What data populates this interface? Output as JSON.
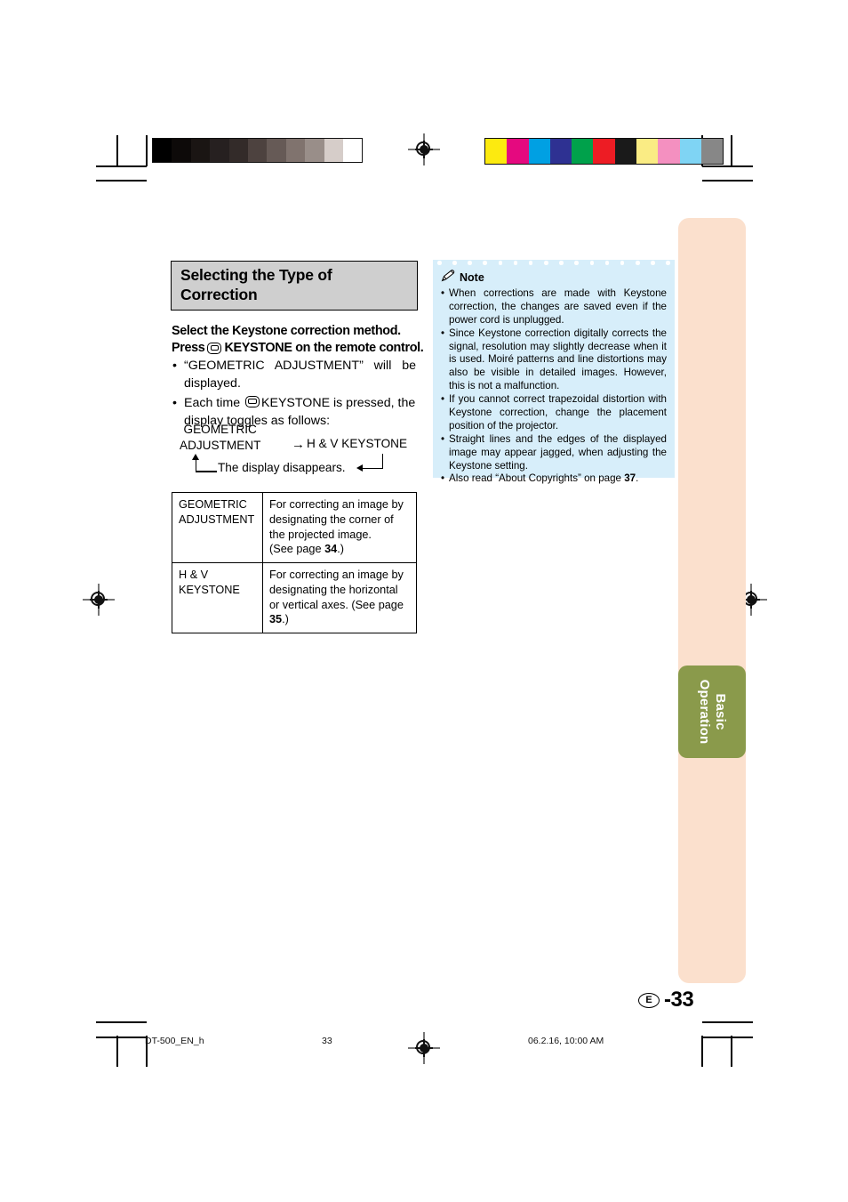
{
  "page": {
    "badge_region": "E",
    "badge_number": "-33"
  },
  "heading": {
    "title": "Selecting the Type of\nCorrection"
  },
  "lead": {
    "line1": "Select the Keystone correction method.",
    "press_prefix": "Press",
    "key_icon": "keystone-button-icon",
    "press_suffix": "KEYSTONE on the remote control."
  },
  "bullets": [
    "“GEOMETRIC ADJUSTMENT” will be displayed.",
    "Each time KEYSTONE is pressed, the display toggles as follows:"
  ],
  "bullet2": {
    "before_icon": "Each time",
    "icon": "keystone-button-icon",
    "after_icon": "KEYSTONE is pressed, the",
    "line2": "display toggles as follows:"
  },
  "flow": {
    "node1": "GEOMETRIC\nADJUSTMENT",
    "arrow": "→",
    "node2": "H & V KEYSTONE",
    "loop_label": "The display disappears."
  },
  "table": {
    "rows": [
      {
        "name": "GEOMETRIC\nADJUSTMENT",
        "desc_pre": "For correcting an image by designating the corner of the projected image.\n(See page ",
        "page": "34",
        "desc_post": ".)"
      },
      {
        "name": "H & V\nKEYSTONE",
        "desc_pre": "For correcting an image by designating the horizontal or vertical axes. (See page ",
        "page": "35",
        "desc_post": ".)"
      }
    ]
  },
  "note": {
    "icon": "pencil-icon",
    "title": "Note",
    "items": [
      {
        "text": "When corrections are made with Keystone correction, the changes are saved even if the power cord is unplugged."
      },
      {
        "text": "Since Keystone correction digitally corrects the signal, resolution may slightly decrease when it is used. Moiré patterns and line distortions may also be visible in detailed images. However, this is not a malfunction."
      },
      {
        "text": "If you cannot correct trapezoidal distortion with Keystone correction, change the placement position of the projector."
      },
      {
        "text": "Straight lines and the edges of the displayed image may appear jagged, when adjusting the Keystone setting."
      },
      {
        "text_pre": "Also read “About Copyrights” on page ",
        "bold": "37",
        "text_post": "."
      }
    ]
  },
  "side_tab": {
    "label": "Basic\nOperation",
    "color": "#8a9a4b"
  },
  "side_panel": {
    "color": "#fbe0cd"
  },
  "footer": {
    "file": "DT-500_EN_h",
    "page": "33",
    "datetime": "06.2.16, 10:00 AM"
  },
  "print_marks": {
    "gray_wedge": [
      "#000000",
      "#0d0a09",
      "#1a1513",
      "#262020",
      "#332b29",
      "#4d423f",
      "#665a56",
      "#80736e",
      "#998e89",
      "#d6cdc9",
      "#ffffff"
    ],
    "color_bars": [
      "#fcea10",
      "#e5097f",
      "#00a0e3",
      "#2e3192",
      "#00a14b",
      "#ed1c24",
      "#1a1a1a",
      "#faec84",
      "#f490c0",
      "#7fd4f4",
      "#878787"
    ]
  }
}
